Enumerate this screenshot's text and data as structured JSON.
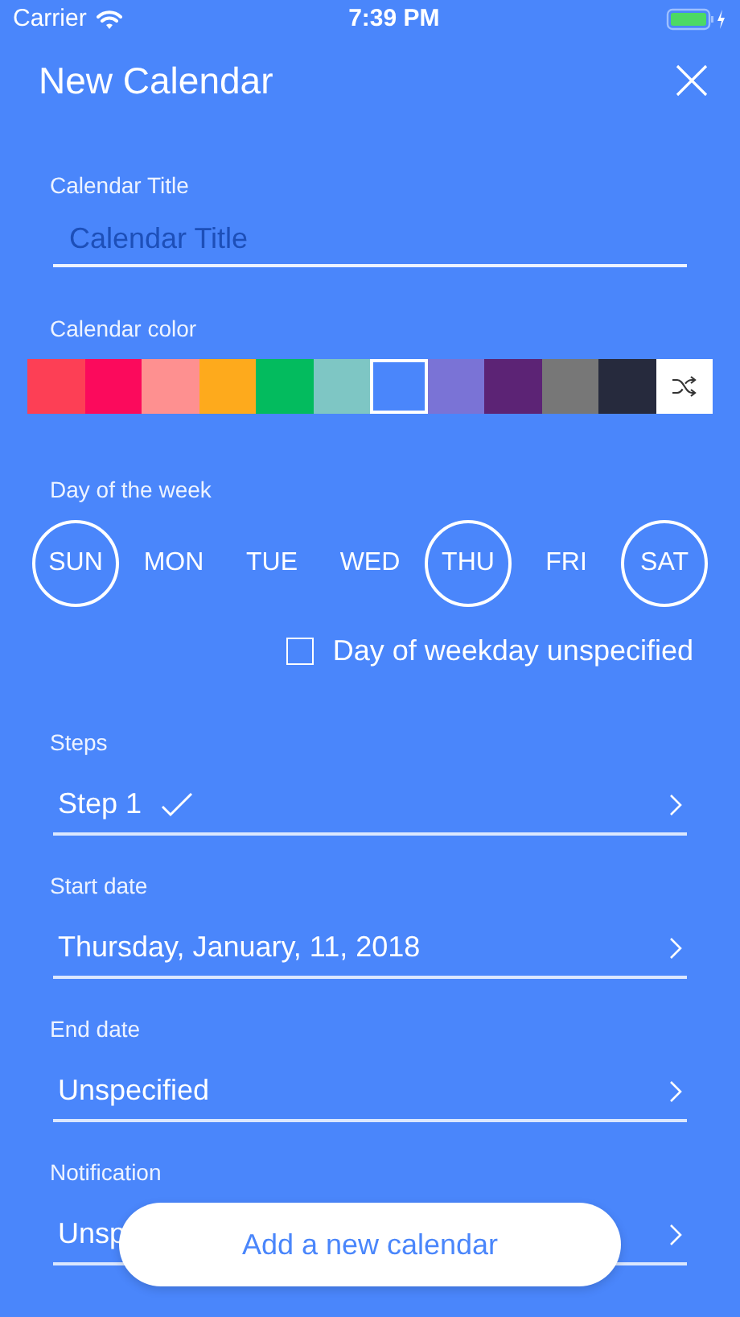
{
  "status_bar": {
    "carrier": "Carrier",
    "time": "7:39 PM"
  },
  "header": {
    "title": "New Calendar"
  },
  "title_field": {
    "label": "Calendar Title",
    "placeholder": "Calendar Title"
  },
  "color_picker": {
    "label": "Calendar color",
    "swatches": [
      {
        "color": "#fd3f55",
        "selected": false
      },
      {
        "color": "#fb0a5c",
        "selected": false
      },
      {
        "color": "#fe9090",
        "selected": false
      },
      {
        "color": "#feaa1c",
        "selected": false
      },
      {
        "color": "#03bb5e",
        "selected": false
      },
      {
        "color": "#7ec6c4",
        "selected": false
      },
      {
        "color": "#4a86fb",
        "selected": true
      },
      {
        "color": "#7a73d6",
        "selected": false
      },
      {
        "color": "#5c2375",
        "selected": false
      },
      {
        "color": "#777777",
        "selected": false
      },
      {
        "color": "#262a3d",
        "selected": false
      }
    ]
  },
  "weekdays": {
    "label": "Day of the week",
    "days": [
      {
        "label": "SUN",
        "selected": true
      },
      {
        "label": "MON",
        "selected": false
      },
      {
        "label": "TUE",
        "selected": false
      },
      {
        "label": "WED",
        "selected": false
      },
      {
        "label": "THU",
        "selected": true
      },
      {
        "label": "FRI",
        "selected": false
      },
      {
        "label": "SAT",
        "selected": true
      }
    ],
    "unspecified": {
      "label": "Day of weekday unspecified",
      "checked": false
    }
  },
  "rows": [
    {
      "label": "Steps",
      "value": "Step 1",
      "done": true
    },
    {
      "label": "Start date",
      "value": "Thursday, January, 11, 2018",
      "done": false
    },
    {
      "label": "End date",
      "value": "Unspecified",
      "done": false
    },
    {
      "label": "Notification",
      "value": "Unsp",
      "done": false
    }
  ],
  "add_button": {
    "label": "Add a new calendar"
  }
}
